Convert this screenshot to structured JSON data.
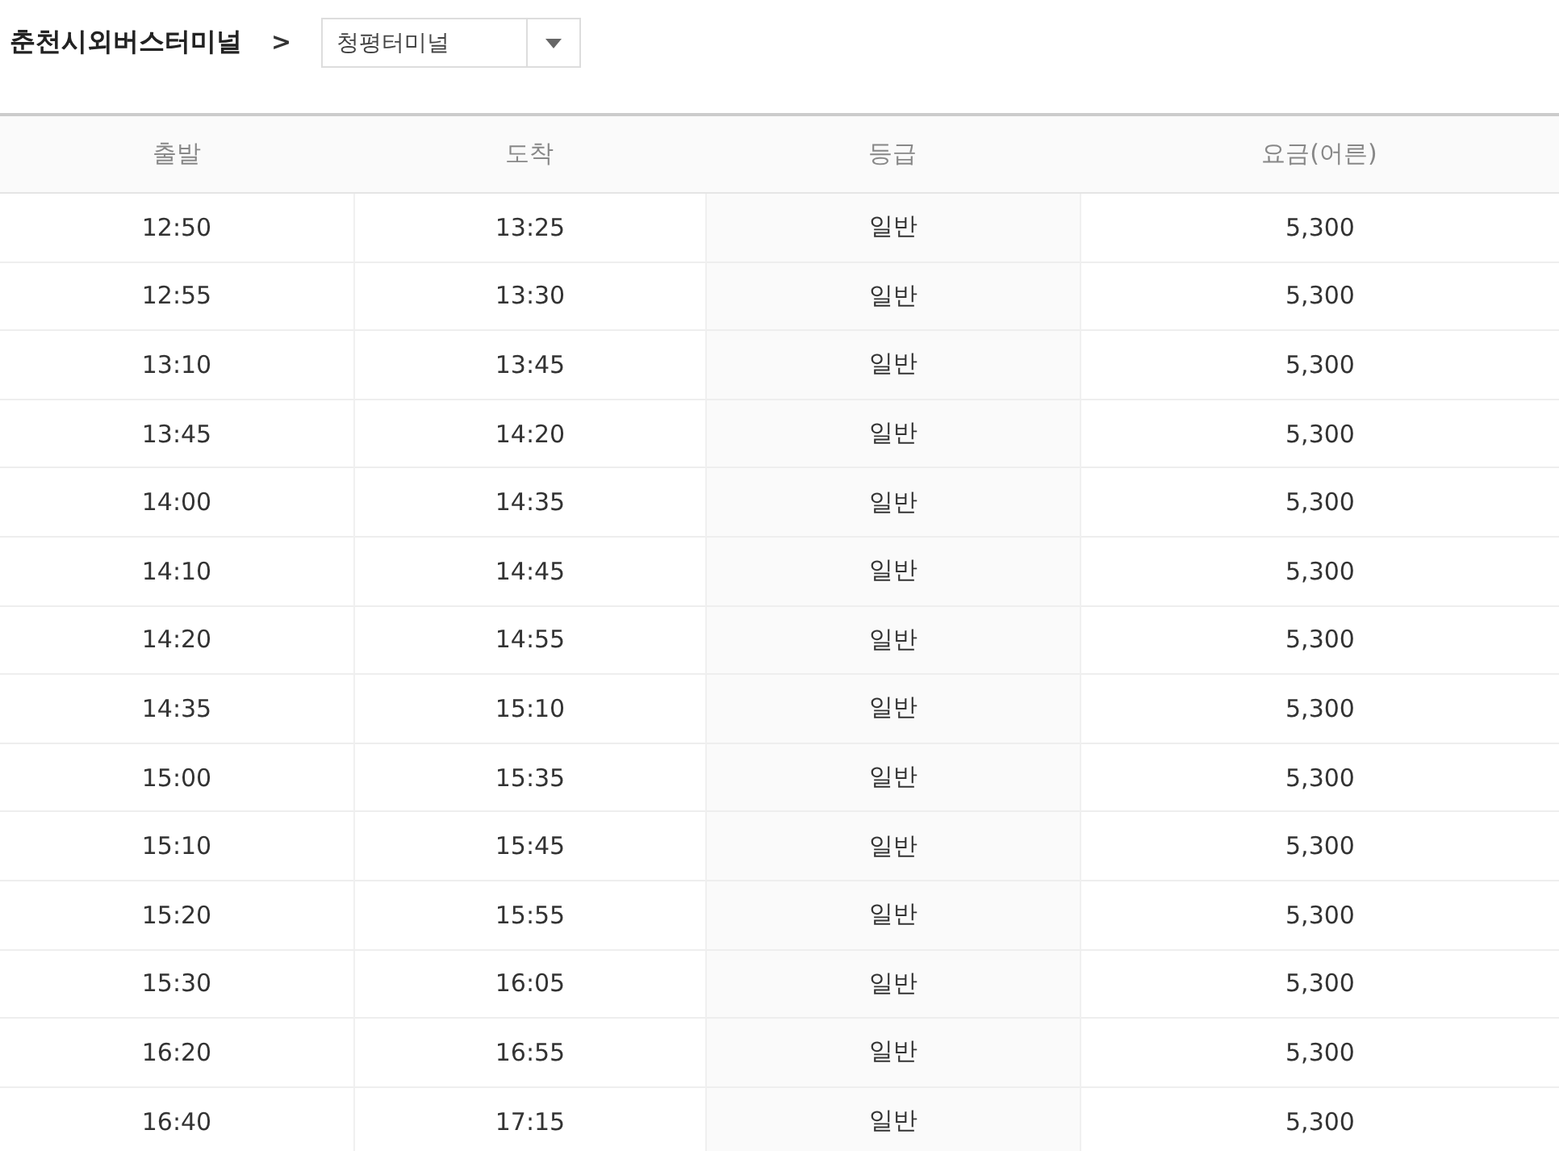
{
  "route": {
    "origin": "춘천시외버스터미널",
    "separator": ">",
    "destination": "청평터미널"
  },
  "table": {
    "columns": [
      "출발",
      "도착",
      "등급",
      "요금(어른)"
    ],
    "rows": [
      [
        "12:50",
        "13:25",
        "일반",
        "5,300"
      ],
      [
        "12:55",
        "13:30",
        "일반",
        "5,300"
      ],
      [
        "13:10",
        "13:45",
        "일반",
        "5,300"
      ],
      [
        "13:45",
        "14:20",
        "일반",
        "5,300"
      ],
      [
        "14:00",
        "14:35",
        "일반",
        "5,300"
      ],
      [
        "14:10",
        "14:45",
        "일반",
        "5,300"
      ],
      [
        "14:20",
        "14:55",
        "일반",
        "5,300"
      ],
      [
        "14:35",
        "15:10",
        "일반",
        "5,300"
      ],
      [
        "15:00",
        "15:35",
        "일반",
        "5,300"
      ],
      [
        "15:10",
        "15:45",
        "일반",
        "5,300"
      ],
      [
        "15:20",
        "15:55",
        "일반",
        "5,300"
      ],
      [
        "15:30",
        "16:05",
        "일반",
        "5,300"
      ],
      [
        "16:20",
        "16:55",
        "일반",
        "5,300"
      ],
      [
        "16:40",
        "17:15",
        "일반",
        "5,300"
      ]
    ]
  }
}
